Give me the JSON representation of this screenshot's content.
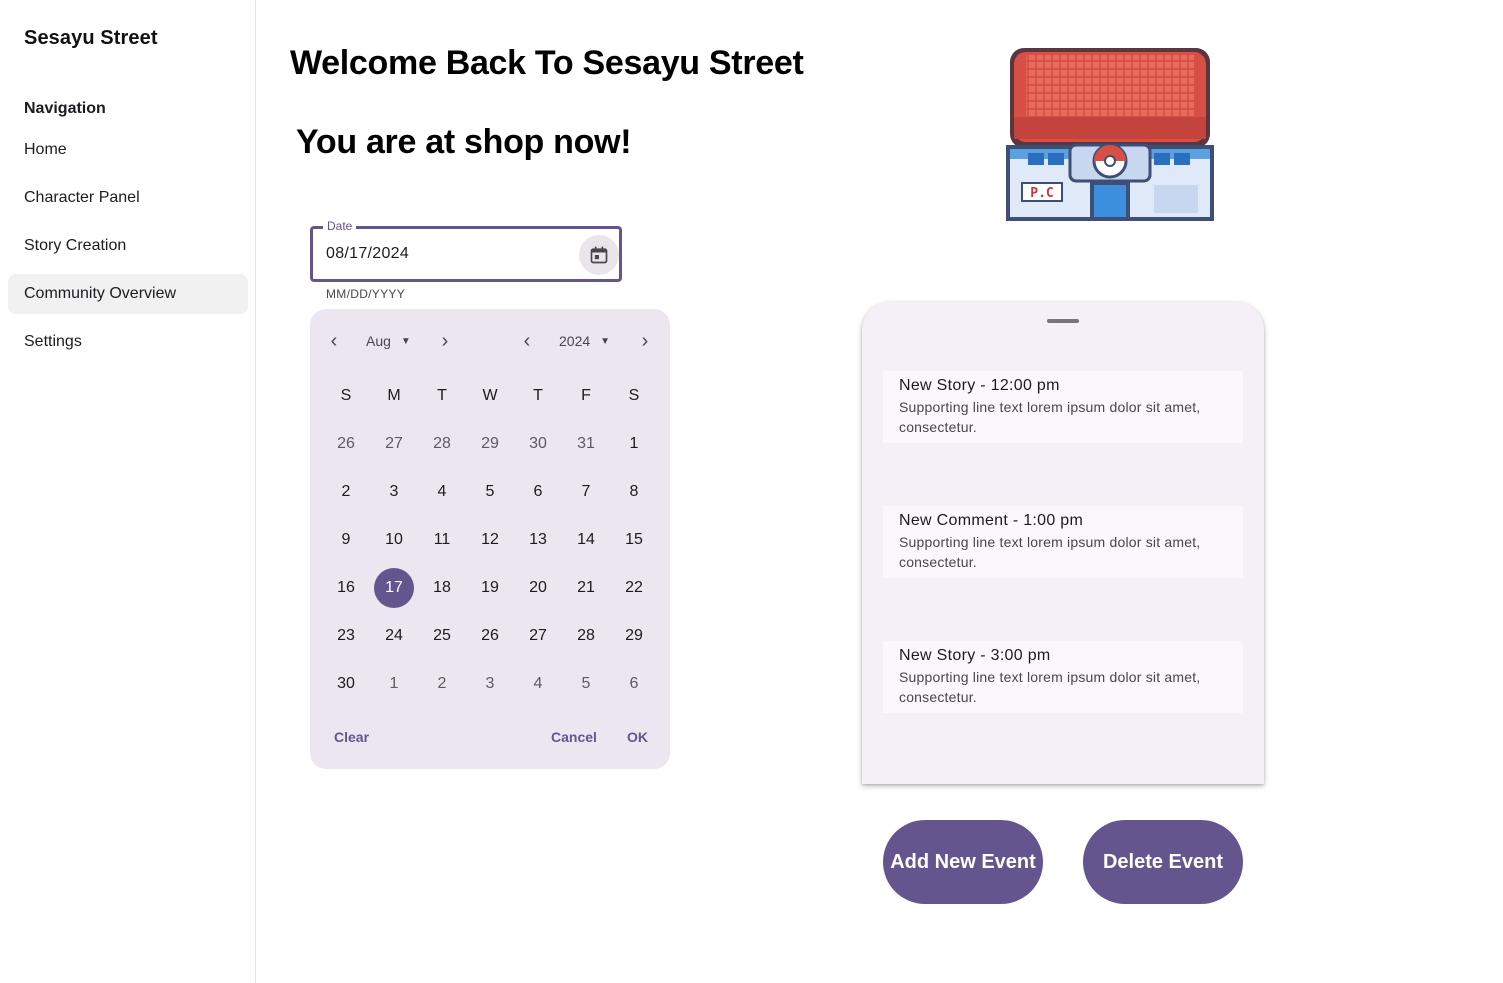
{
  "app": {
    "title": "Sesayu Street"
  },
  "sidebar": {
    "heading": "Navigation",
    "items": [
      {
        "label": "Home",
        "active": false
      },
      {
        "label": "Character Panel",
        "active": false
      },
      {
        "label": "Story Creation",
        "active": false
      },
      {
        "label": "Community Overview",
        "active": true
      },
      {
        "label": "Settings",
        "active": false
      }
    ]
  },
  "main": {
    "welcome": "Welcome Back To Sesayu Street",
    "location": "You are at shop now!"
  },
  "date_field": {
    "label": "Date",
    "value": "08/17/2024",
    "hint": "MM/DD/YYYY",
    "icon": "calendar-icon"
  },
  "calendar": {
    "month": "Aug",
    "year": "2024",
    "weekdays": [
      "S",
      "M",
      "T",
      "W",
      "T",
      "F",
      "S"
    ],
    "weeks": [
      [
        "26",
        "27",
        "28",
        "29",
        "30",
        "31",
        "1"
      ],
      [
        "2",
        "3",
        "4",
        "5",
        "6",
        "7",
        "8"
      ],
      [
        "9",
        "10",
        "11",
        "12",
        "13",
        "14",
        "15"
      ],
      [
        "16",
        "17",
        "18",
        "19",
        "20",
        "21",
        "22"
      ],
      [
        "23",
        "24",
        "25",
        "26",
        "27",
        "28",
        "29"
      ],
      [
        "30",
        "1",
        "2",
        "3",
        "4",
        "5",
        "6"
      ]
    ],
    "selected": "17",
    "actions": {
      "clear": "Clear",
      "cancel": "Cancel",
      "ok": "OK"
    }
  },
  "logo": {
    "text": "P.C",
    "icon": "pokemon-center-icon"
  },
  "events": [
    {
      "title": "New Story - 12:00 pm",
      "text": "Supporting line text lorem ipsum dolor sit amet, consectetur."
    },
    {
      "title": "New Comment - 1:00 pm",
      "text": "Supporting line text lorem ipsum dolor sit amet, consectetur."
    },
    {
      "title": "New Story - 3:00 pm",
      "text": "Supporting line text lorem ipsum dolor sit amet, consectetur."
    }
  ],
  "buttons": {
    "add": "Add New Event",
    "delete": "Delete Event"
  },
  "colors": {
    "accent": "#65558f",
    "calendar_bg": "#ece6f0",
    "panel_bg": "#f5eff7"
  }
}
